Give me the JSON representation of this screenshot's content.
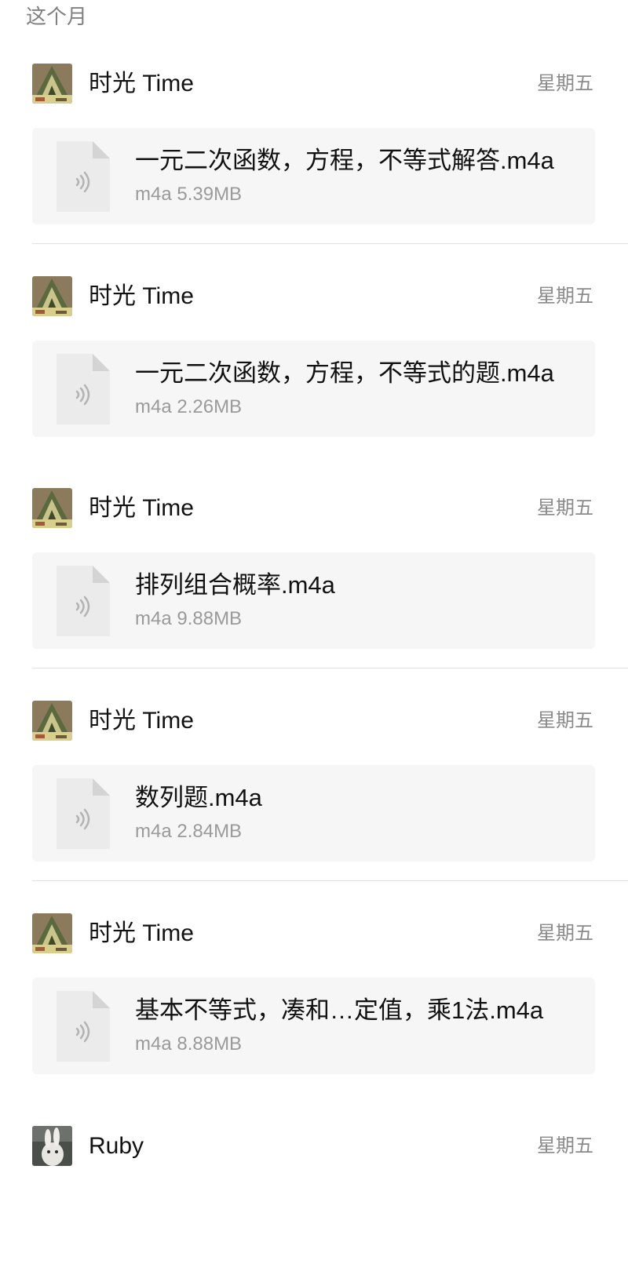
{
  "section_title": "这个月",
  "entries": [
    {
      "sender": "时光 Time",
      "date": "星期五",
      "avatar_icon": "avatar-time-photo",
      "file_icon": "audio-file-icon",
      "file_name": "一元二次函数，方程，不等式解答.m4a",
      "file_meta": "m4a 5.39MB"
    },
    {
      "sender": "时光 Time",
      "date": "星期五",
      "avatar_icon": "avatar-time-photo",
      "file_icon": "audio-file-icon",
      "file_name": "一元二次函数，方程，不等式的题.m4a",
      "file_meta": "m4a 2.26MB"
    },
    {
      "sender": "时光 Time",
      "date": "星期五",
      "avatar_icon": "avatar-time-photo",
      "file_icon": "audio-file-icon",
      "file_name": "排列组合概率.m4a",
      "file_meta": "m4a 9.88MB"
    },
    {
      "sender": "时光 Time",
      "date": "星期五",
      "avatar_icon": "avatar-time-photo",
      "file_icon": "audio-file-icon",
      "file_name": "数列题.m4a",
      "file_meta": "m4a 2.84MB"
    },
    {
      "sender": "时光 Time",
      "date": "星期五",
      "avatar_icon": "avatar-time-photo",
      "file_icon": "audio-file-icon",
      "file_name": "基本不等式，凑和…定值，乘1法.m4a",
      "file_meta": "m4a 8.88MB"
    },
    {
      "sender": "Ruby",
      "date": "星期五",
      "avatar_icon": "avatar-ruby-photo"
    }
  ],
  "colors": {
    "card_background": "#f6f6f6",
    "divider": "#e2e2e2",
    "secondary_text": "#8a8a8a"
  }
}
